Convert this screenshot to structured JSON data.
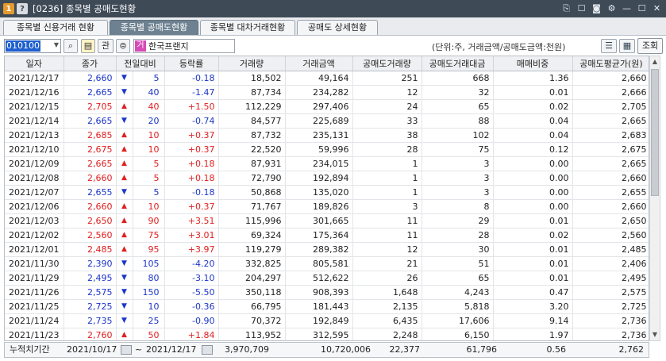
{
  "window": {
    "screen_no": "1",
    "title": "[0236] 종목별 공매도현황",
    "help_badge": "?"
  },
  "tabs": [
    {
      "label": "종목별 신용거래 현황",
      "active": false
    },
    {
      "label": "종목별 공매도현황",
      "active": true
    },
    {
      "label": "종목별 대차거래현황",
      "active": false
    },
    {
      "label": "공매도 상세현황",
      "active": false
    }
  ],
  "toolbar": {
    "stock_code": "010100",
    "watch_label": "관",
    "stock_tag": "거",
    "stock_name": "한국프랜지",
    "unit_text": "(단위:주, 거래금액/공매도금액:천원)",
    "query_label": "조회"
  },
  "table": {
    "headers": [
      "일자",
      "종가",
      "전일대비",
      "등락률",
      "거래량",
      "거래금액",
      "공매도거래량",
      "공매도거래대금",
      "매매비중",
      "공매도평균가(원)"
    ],
    "rows": [
      {
        "date": "2021/12/17",
        "close": "2,660",
        "dir": "down",
        "diff": "5",
        "rate": "-0.18",
        "volume": "18,502",
        "amount": "49,164",
        "short_vol": "251",
        "short_amt": "668",
        "ratio": "1.36",
        "short_avg": "2,660"
      },
      {
        "date": "2021/12/16",
        "close": "2,665",
        "dir": "down",
        "diff": "40",
        "rate": "-1.47",
        "volume": "87,734",
        "amount": "234,282",
        "short_vol": "12",
        "short_amt": "32",
        "ratio": "0.01",
        "short_avg": "2,666"
      },
      {
        "date": "2021/12/15",
        "close": "2,705",
        "dir": "up",
        "diff": "40",
        "rate": "+1.50",
        "volume": "112,229",
        "amount": "297,406",
        "short_vol": "24",
        "short_amt": "65",
        "ratio": "0.02",
        "short_avg": "2,705"
      },
      {
        "date": "2021/12/14",
        "close": "2,665",
        "dir": "down",
        "diff": "20",
        "rate": "-0.74",
        "volume": "84,577",
        "amount": "225,689",
        "short_vol": "33",
        "short_amt": "88",
        "ratio": "0.04",
        "short_avg": "2,665"
      },
      {
        "date": "2021/12/13",
        "close": "2,685",
        "dir": "up",
        "diff": "10",
        "rate": "+0.37",
        "volume": "87,732",
        "amount": "235,131",
        "short_vol": "38",
        "short_amt": "102",
        "ratio": "0.04",
        "short_avg": "2,683"
      },
      {
        "date": "2021/12/10",
        "close": "2,675",
        "dir": "up",
        "diff": "10",
        "rate": "+0.37",
        "volume": "22,520",
        "amount": "59,996",
        "short_vol": "28",
        "short_amt": "75",
        "ratio": "0.12",
        "short_avg": "2,675"
      },
      {
        "date": "2021/12/09",
        "close": "2,665",
        "dir": "up",
        "diff": "5",
        "rate": "+0.18",
        "volume": "87,931",
        "amount": "234,015",
        "short_vol": "1",
        "short_amt": "3",
        "ratio": "0.00",
        "short_avg": "2,665"
      },
      {
        "date": "2021/12/08",
        "close": "2,660",
        "dir": "up",
        "diff": "5",
        "rate": "+0.18",
        "volume": "72,790",
        "amount": "192,894",
        "short_vol": "1",
        "short_amt": "3",
        "ratio": "0.00",
        "short_avg": "2,660"
      },
      {
        "date": "2021/12/07",
        "close": "2,655",
        "dir": "down",
        "diff": "5",
        "rate": "-0.18",
        "volume": "50,868",
        "amount": "135,020",
        "short_vol": "1",
        "short_amt": "3",
        "ratio": "0.00",
        "short_avg": "2,655"
      },
      {
        "date": "2021/12/06",
        "close": "2,660",
        "dir": "up",
        "diff": "10",
        "rate": "+0.37",
        "volume": "71,767",
        "amount": "189,826",
        "short_vol": "3",
        "short_amt": "8",
        "ratio": "0.00",
        "short_avg": "2,660"
      },
      {
        "date": "2021/12/03",
        "close": "2,650",
        "dir": "up",
        "diff": "90",
        "rate": "+3.51",
        "volume": "115,996",
        "amount": "301,665",
        "short_vol": "11",
        "short_amt": "29",
        "ratio": "0.01",
        "short_avg": "2,650"
      },
      {
        "date": "2021/12/02",
        "close": "2,560",
        "dir": "up",
        "diff": "75",
        "rate": "+3.01",
        "volume": "69,324",
        "amount": "175,364",
        "short_vol": "11",
        "short_amt": "28",
        "ratio": "0.02",
        "short_avg": "2,560"
      },
      {
        "date": "2021/12/01",
        "close": "2,485",
        "dir": "up",
        "diff": "95",
        "rate": "+3.97",
        "volume": "119,279",
        "amount": "289,382",
        "short_vol": "12",
        "short_amt": "30",
        "ratio": "0.01",
        "short_avg": "2,485"
      },
      {
        "date": "2021/11/30",
        "close": "2,390",
        "dir": "down",
        "diff": "105",
        "rate": "-4.20",
        "volume": "332,825",
        "amount": "805,581",
        "short_vol": "21",
        "short_amt": "51",
        "ratio": "0.01",
        "short_avg": "2,406"
      },
      {
        "date": "2021/11/29",
        "close": "2,495",
        "dir": "down",
        "diff": "80",
        "rate": "-3.10",
        "volume": "204,297",
        "amount": "512,622",
        "short_vol": "26",
        "short_amt": "65",
        "ratio": "0.01",
        "short_avg": "2,495"
      },
      {
        "date": "2021/11/26",
        "close": "2,575",
        "dir": "down",
        "diff": "150",
        "rate": "-5.50",
        "volume": "350,118",
        "amount": "908,393",
        "short_vol": "1,648",
        "short_amt": "4,243",
        "ratio": "0.47",
        "short_avg": "2,575"
      },
      {
        "date": "2021/11/25",
        "close": "2,725",
        "dir": "down",
        "diff": "10",
        "rate": "-0.36",
        "volume": "66,795",
        "amount": "181,443",
        "short_vol": "2,135",
        "short_amt": "5,818",
        "ratio": "3.20",
        "short_avg": "2,725"
      },
      {
        "date": "2021/11/24",
        "close": "2,735",
        "dir": "down",
        "diff": "25",
        "rate": "-0.90",
        "volume": "70,372",
        "amount": "192,849",
        "short_vol": "6,435",
        "short_amt": "17,606",
        "ratio": "9.14",
        "short_avg": "2,736"
      },
      {
        "date": "2021/11/23",
        "close": "2,760",
        "dir": "up",
        "diff": "50",
        "rate": "+1.84",
        "volume": "113,952",
        "amount": "312,595",
        "short_vol": "2,248",
        "short_amt": "6,150",
        "ratio": "1.97",
        "short_avg": "2,736"
      }
    ]
  },
  "footer": {
    "label": "누적치기간",
    "from": "2021/10/17",
    "sep": "~",
    "to": "2021/12/17",
    "volume": "3,970,709",
    "amount": "10,720,006",
    "short_vol": "22,377",
    "short_amt": "61,796",
    "ratio": "0.56",
    "short_avg": "2,762"
  },
  "colors": {
    "up": "#e02020",
    "down": "#1c35c8",
    "titlebar": "#3f4a57",
    "active_tab": "#6d8190"
  },
  "icons": {
    "up": "▲",
    "down": "▼"
  }
}
